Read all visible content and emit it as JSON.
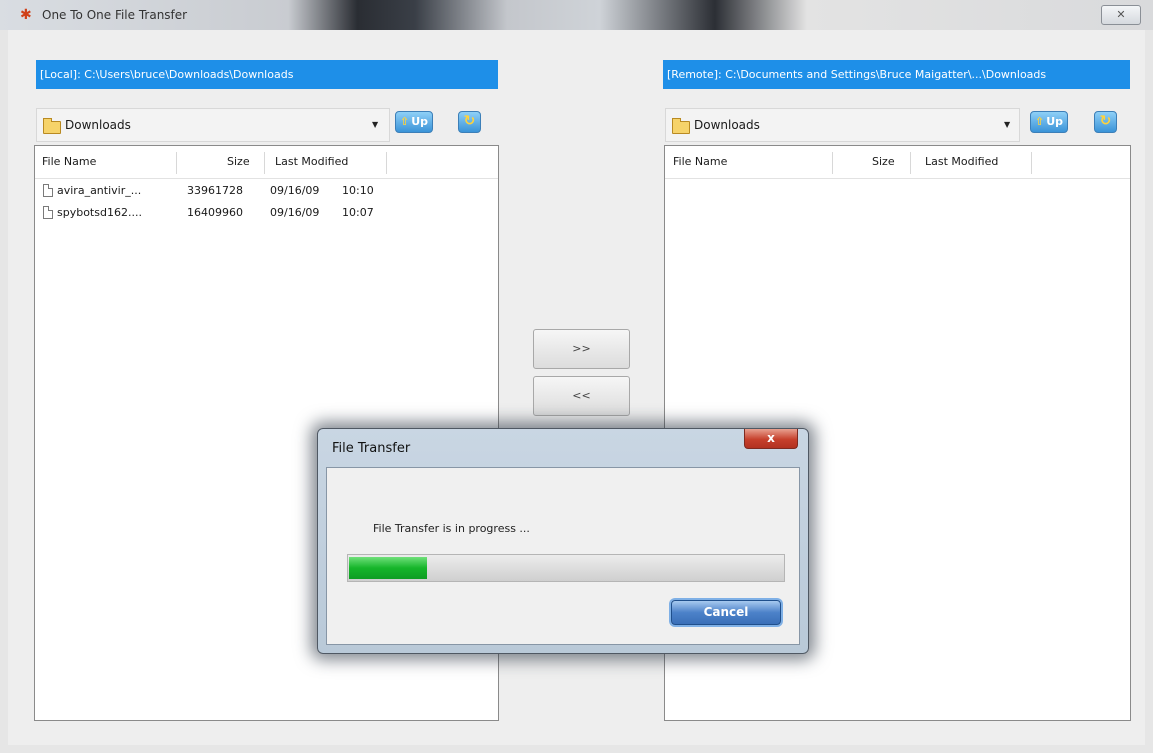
{
  "window": {
    "title": "One To One File Transfer",
    "close_glyph": "✕"
  },
  "local": {
    "path": "[Local]: C:\\Users\\bruce\\Downloads\\Downloads",
    "folder": "Downloads",
    "up_label": "Up",
    "columns": [
      "File Name",
      "Size",
      "Last Modified"
    ],
    "files": [
      {
        "name": "avira_antivir_...",
        "size": "33961728",
        "date": "09/16/09",
        "time": "10:10"
      },
      {
        "name": "spybotsd162....",
        "size": "16409960",
        "date": "09/16/09",
        "time": "10:07"
      }
    ]
  },
  "remote": {
    "path": "[Remote]: C:\\Documents and Settings\\Bruce Maigatter\\...\\Downloads",
    "folder": "Downloads",
    "up_label": "Up",
    "columns": [
      "File Name",
      "Size",
      "Last Modified"
    ],
    "files": []
  },
  "transfer": {
    "send_label": ">>",
    "receive_label": "<<"
  },
  "dialog": {
    "title": "File Transfer",
    "message": "File Transfer is in progress ...",
    "progress": 0.18,
    "cancel_label": "Cancel",
    "close_glyph": "x"
  },
  "icons": {
    "app": "app-icon",
    "folder": "folder-icon",
    "file": "file-icon",
    "up": "up-arrow-icon",
    "refresh": "refresh-icon",
    "dropdown": "chevron-down-icon"
  },
  "colors": {
    "path_bar": "#1e8fe8",
    "progress": "#16b52a",
    "cancel": "#4c82c9"
  }
}
